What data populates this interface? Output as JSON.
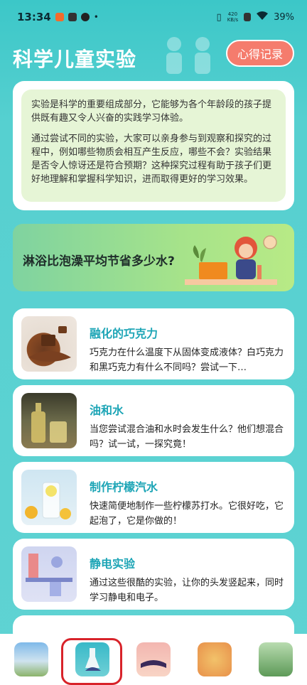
{
  "status_bar": {
    "time": "13:34",
    "net_speed_value": "420",
    "net_speed_unit": "KB/s",
    "battery": "39%"
  },
  "header": {
    "title": "科学儿童实验",
    "notes_button": "心得记录"
  },
  "intro": {
    "paragraph_1": "实验是科学的重要组成部分，它能够为各个年龄段的孩子提供既有趣又令人兴奋的实践学习体验。",
    "paragraph_2": "通过尝试不同的实验，大家可以亲身参与到观察和探究的过程中，例如哪些物质会相互产生反应，哪些不会？实验结果是否令人惊讶还是符合预期？这种探究过程有助于孩子们更好地理解和掌握科学知识，进而取得更好的学习效果。"
  },
  "banner": {
    "text": "淋浴比泡澡平均节省多少水?"
  },
  "experiments": [
    {
      "title": "融化的巧克力",
      "desc": "巧克力在什么温度下从固体变成液体？白巧克力和黑巧克力有什么不同吗？尝试一下…",
      "icon": "chocolate-image"
    },
    {
      "title": "油和水",
      "desc": "当您尝试混合油和水时会发生什么？他们想混合吗？试一试，一探究竟！",
      "icon": "oil-bottle-image"
    },
    {
      "title": "制作柠檬汽水",
      "desc": "快速简便地制作一些柠檬苏打水。它很好吃，它起泡了，它是你做的！",
      "icon": "lemonade-image"
    },
    {
      "title": "静电实验",
      "desc": "通过这些很酷的实验，让你的头发竖起来，同时学习静电和电子。",
      "icon": "lab-image"
    }
  ],
  "tabs": [
    {
      "name": "tab-landscape",
      "icon": "landscape-icon"
    },
    {
      "name": "tab-experiment",
      "icon": "flask-hand-icon",
      "selected": true
    },
    {
      "name": "tab-reading",
      "icon": "book-icon"
    },
    {
      "name": "tab-autumn",
      "icon": "leaves-icon"
    },
    {
      "name": "tab-plants",
      "icon": "plant-icon"
    }
  ],
  "colors": {
    "accent": "#1da5b6",
    "button": "#f57c6d",
    "selection": "#d8232a"
  }
}
